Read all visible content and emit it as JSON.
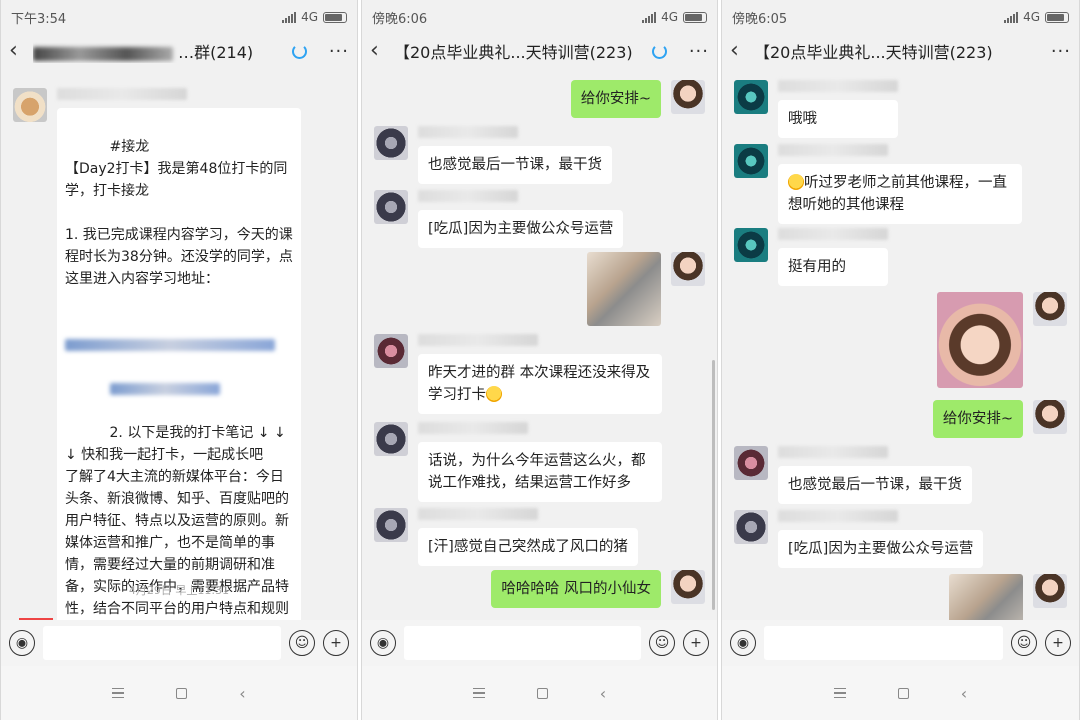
{
  "phones": [
    {
      "status_time": "下午3:54",
      "network": "4G",
      "title": "…群(214)",
      "messages": [
        {
          "side": "left",
          "text": "#接龙\n【Day2打卡】我是第48位打卡的同学，打卡接龙\n\n1. 我已完成课程内容学习，今天的课程时长为38分钟。还没学的同学，点这里进入内容学习地址：",
          "link_tail": "2. 以下是我的打卡笔记 ↓ ↓ ↓ 快和我一起打卡，一起成长吧\n了解了4大主流的新媒体平台：今日头条、新浪微博、知乎、百度贴吧的用户特征、特点以及运营的原则。新媒体运营和推广，也不是简单的事情，需要经过大量的前期调研和准备，实际的运作中，需要根据产品特性，结合不同平台的用户特点和规则进行内容推广，有机串联各个新媒体平台，才能事半功倍。"
        }
      ],
      "timestamp": "4月29日 早上11:31"
    },
    {
      "status_time": "傍晚6:06",
      "network": "4G",
      "title": "【20点毕业典礼...天特训营(223)",
      "messages": [
        {
          "side": "right",
          "text": "给你安排~"
        },
        {
          "side": "left",
          "text": "也感觉最后一节课，最干货"
        },
        {
          "side": "left",
          "text": "[吃瓜]因为主要做公众号运营"
        },
        {
          "side": "right",
          "image": "cat-photo"
        },
        {
          "side": "left",
          "text": "昨天才进的群 本次课程还没来得及学习打卡"
        },
        {
          "side": "left",
          "text": "话说，为什么今年运营这么火，都说工作难找，结果运营工作好多"
        },
        {
          "side": "left",
          "text": "[汗]感觉自己突然成了风口的猪"
        },
        {
          "side": "right",
          "text": "哈哈哈哈 风口的小仙女"
        }
      ]
    },
    {
      "status_time": "傍晚6:05",
      "network": "4G",
      "title": "【20点毕业典礼...天特训营(223)",
      "messages": [
        {
          "side": "left",
          "text": "哦哦"
        },
        {
          "side": "left",
          "text": "听过罗老师之前其他课程，一直想听她的其他课程"
        },
        {
          "side": "left",
          "text": "挺有用的"
        },
        {
          "side": "right",
          "image": "girl-photo"
        },
        {
          "side": "right",
          "text": "给你安排~"
        },
        {
          "side": "left",
          "text": "也感觉最后一节课，最干货"
        },
        {
          "side": "left",
          "text": "[吃瓜]因为主要做公众号运营"
        },
        {
          "side": "right",
          "image": "cat-photo"
        }
      ]
    }
  ],
  "icons": {
    "back": "chevron-left-icon",
    "loading": "loading-ring-icon",
    "more": "more-dots-icon",
    "voice": "voice-icon",
    "emoji": "emoji-icon",
    "add": "add-icon"
  },
  "colors": {
    "bubble_green": "#9eea6a",
    "accent_blue": "#2ea3f2",
    "chat_bg": "#f1f1f1"
  }
}
